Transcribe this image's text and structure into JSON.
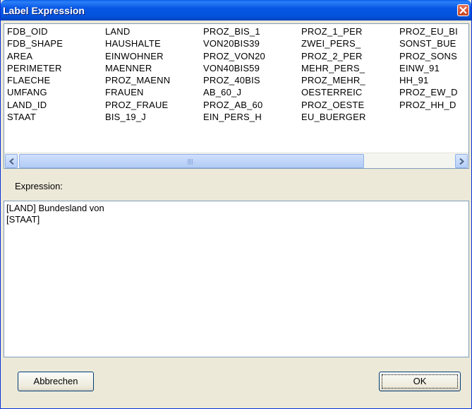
{
  "window": {
    "title": "Label Expression"
  },
  "fields": {
    "columns": [
      [
        "FDB_OID",
        "FDB_SHAPE",
        "AREA",
        "PERIMETER",
        "FLAECHE",
        "UMFANG",
        "LAND_ID",
        "STAAT"
      ],
      [
        "LAND",
        "HAUSHALTE",
        "EINWOHNER",
        "MAENNER",
        "PROZ_MAENN",
        "FRAUEN",
        "PROZ_FRAUE",
        "BIS_19_J"
      ],
      [
        "PROZ_BIS_1",
        "VON20BIS39",
        "PROZ_VON20",
        "VON40BIS59",
        "PROZ_40BIS",
        "AB_60_J",
        "PROZ_AB_60",
        "EIN_PERS_H"
      ],
      [
        "PROZ_1_PER",
        "ZWEI_PERS_",
        "PROZ_2_PER",
        "MEHR_PERS_",
        "PROZ_MEHR_",
        "OESTERREIC",
        "PROZ_OESTE",
        "EU_BUERGER"
      ],
      [
        "PROZ_EU_BI",
        "SONST_BUE",
        "PROZ_SONS",
        "EINW_91",
        "HH_91",
        "PROZ_EW_D",
        "PROZ_HH_D"
      ]
    ]
  },
  "expression": {
    "label": "Expression:",
    "lines": [
      "[LAND] Bundesland von",
      "[STAAT]"
    ]
  },
  "buttons": {
    "cancel": "Abbrechen",
    "ok": "OK"
  }
}
